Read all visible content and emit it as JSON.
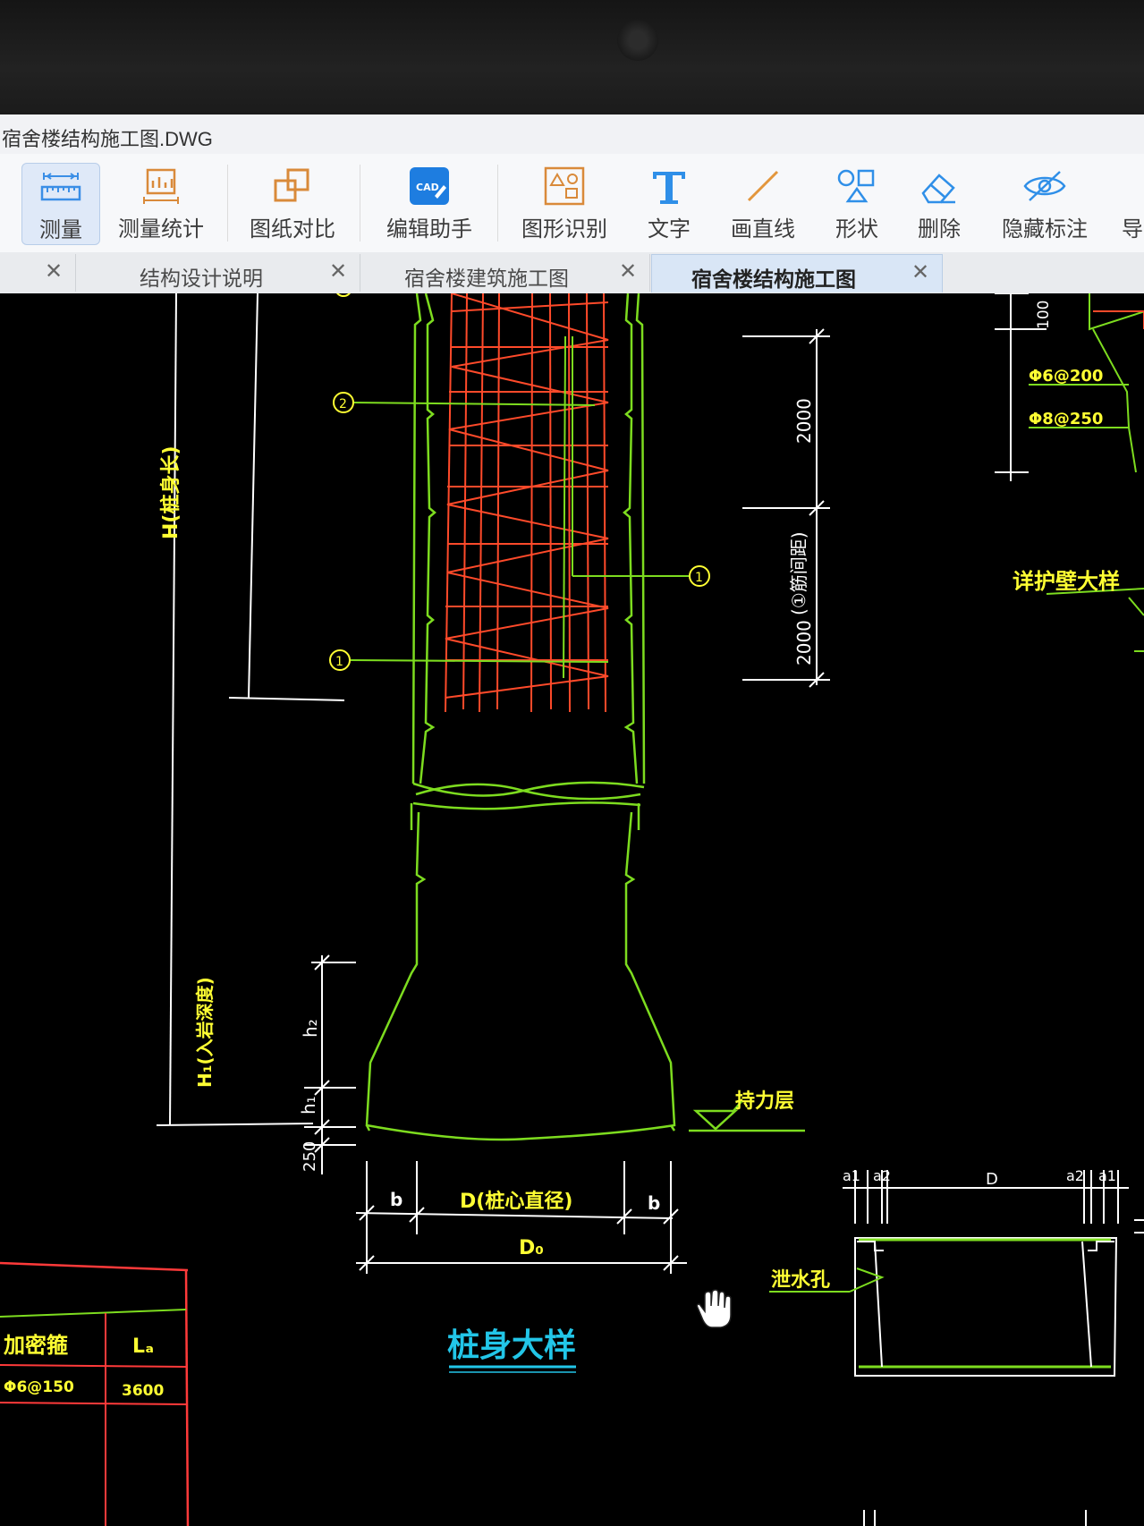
{
  "window": {
    "title": "宿舍楼结构施工图.DWG"
  },
  "toolbar": {
    "items": [
      {
        "label": "测量",
        "icon": "ruler-icon",
        "active": true
      },
      {
        "label": "测量统计",
        "icon": "measure-stats-icon"
      },
      {
        "label": "图纸对比",
        "icon": "compare-icon"
      },
      {
        "label": "编辑助手",
        "icon": "cad-edit-icon"
      },
      {
        "label": "图形识别",
        "icon": "shape-recognize-icon"
      },
      {
        "label": "文字",
        "icon": "text-icon"
      },
      {
        "label": "画直线",
        "icon": "line-icon"
      },
      {
        "label": "形状",
        "icon": "shapes-icon"
      },
      {
        "label": "删除",
        "icon": "eraser-icon"
      },
      {
        "label": "隐藏标注",
        "icon": "eye-hide-icon"
      },
      {
        "label": "导",
        "icon": ""
      }
    ]
  },
  "tabs": [
    {
      "label": ""
    },
    {
      "label": "结构设计说明"
    },
    {
      "label": "宿舍楼建筑施工图"
    },
    {
      "label": "宿舍楼结构施工图",
      "active": true
    }
  ],
  "drawing": {
    "colors": {
      "outline": "#7ddc1f",
      "rebar": "#ff4a2a",
      "dim": "#ffffff",
      "text": "#ffff33",
      "title": "#22c6e8",
      "table": "#ff3a3a"
    },
    "labels": {
      "pile_length": "H(桩身长)",
      "enlarge_height": "H₁(入岩深度)",
      "spacing_note": "(①筋间距)",
      "dim_2000_top": "2000",
      "dim_2000_bottom": "2000",
      "dim_100": "100",
      "rebar_top": "Φ6@200",
      "rebar_mid": "Φ8@250",
      "retaining_wall": "详护壁大样",
      "bearing_layer": "持力层",
      "h2": "h₂",
      "h1": "h₁",
      "dim_250": "250",
      "b_left": "b",
      "b_right": "b",
      "core_diameter": "D(桩心直径)",
      "d0": "D₀",
      "a1_left": "a1",
      "a2_left": "a2",
      "d_right": "D",
      "a2_right": "a2",
      "a1_right": "a1",
      "drain_hole": "泄水孔",
      "detail_title": "桩身大样",
      "callout_1": "1",
      "callout_2": "2"
    },
    "table": {
      "headers": [
        "加密箍",
        "Lₐ"
      ],
      "rows": [
        [
          "Φ6@150",
          "3600"
        ]
      ]
    }
  }
}
